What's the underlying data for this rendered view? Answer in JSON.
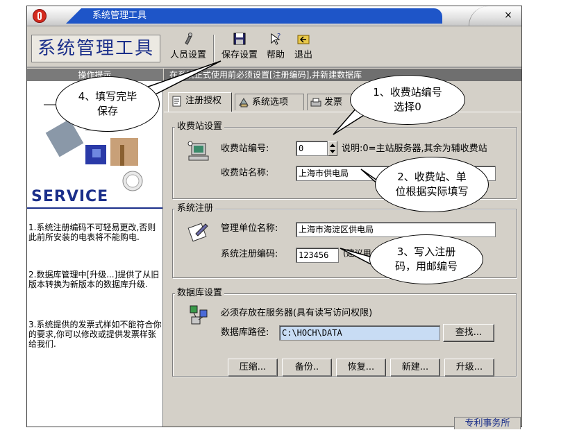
{
  "window": {
    "title": "系统管理工具",
    "close_label": "×"
  },
  "header": {
    "brand": "系统管理工具",
    "toolbar": [
      {
        "label": "人员设置",
        "icon": "user-settings-icon"
      },
      {
        "label": "保存设置",
        "icon": "save-icon"
      },
      {
        "label": "帮助",
        "icon": "help-icon"
      },
      {
        "label": "退出",
        "icon": "exit-icon"
      }
    ]
  },
  "left_panel": {
    "header": "操作提示",
    "service_text": "SERVICE",
    "tips": [
      "1.系统注册编码不可轻易更改,否则此前所安装的电表将不能购电.",
      "2.数据库管理中[升级...]提供了从旧版本转换为新版本的数据库升级.",
      "3.系统提供的发票式样如不能符合你的要求,你可以修改或提供发票样张给我们."
    ]
  },
  "hint_bar": "在系统正式使用前必须设置[注册编码],并新建数据库",
  "tabs": [
    {
      "label": "注册授权",
      "icon": "register-icon",
      "active": true
    },
    {
      "label": "系统选项",
      "icon": "options-icon",
      "active": false
    },
    {
      "label": "发票",
      "icon": "printer-icon",
      "active": false
    }
  ],
  "station": {
    "title": "收费站设置",
    "number_label": "收费站编号:",
    "number_value": "0",
    "explain": "说明:0=主站服务器,其余为辅收费站",
    "name_label": "收费站名称:",
    "name_value": "上海市供电局"
  },
  "register": {
    "title": "系统注册",
    "org_label": "管理单位名称:",
    "org_value": "上海市海淀区供电局",
    "code_label": "系统注册编码:",
    "code_value": "123456",
    "code_hint": "(建议用"
  },
  "database": {
    "title": "数据库设置",
    "note": "必须存放在服务器(具有读写访问权限)",
    "path_label": "数据库路径:",
    "path_value": "C:\\HOCH\\DATA",
    "find_button": "查找...",
    "buttons": [
      "压缩...",
      "备份..",
      "恢复...",
      "新建...",
      "升级..."
    ]
  },
  "callouts": {
    "save": "4、填写完毕保存",
    "station_no": "1、收费站编号选择0",
    "station_name": "2、收费站、单位根据实际填写",
    "reg_code": "3、写入注册码，用邮编号"
  },
  "footer_tab": "专利事务所",
  "colors": {
    "title_blue": "#1e55c8",
    "brand_navy": "#1b2f8a",
    "face": "#d4d0c8",
    "path_highlight": "#c8dcf4"
  }
}
